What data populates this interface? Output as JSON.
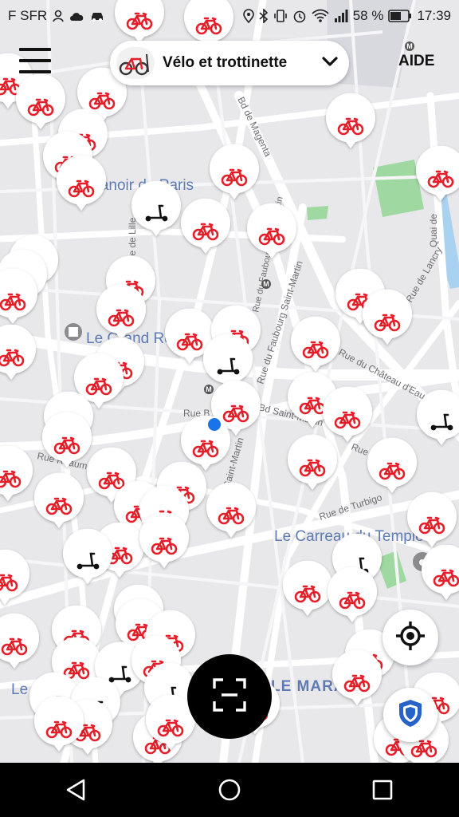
{
  "status_bar": {
    "carrier": "F SFR",
    "battery": "58 %",
    "time": "17:39",
    "icons": [
      "person-icon",
      "cloud-icon",
      "car-icon",
      "location-icon",
      "bluetooth-icon",
      "vibrate-icon",
      "alarm-icon",
      "wifi-icon",
      "signal-icon",
      "battery-icon"
    ]
  },
  "header": {
    "menu_icon": "hamburger-menu-icon",
    "mode_selector": {
      "label": "Vélo et trottinette",
      "icon": "bike-scooter-icon",
      "chevron": "chevron-down-icon"
    },
    "help_label": "AIDE"
  },
  "map": {
    "labels": {
      "street_bd_magenta": "Bd de Magenta",
      "street_faubourg_st_martin": "Rue du Faubourg Saint-Martin",
      "street_bd_st_martin": "Bd Saint-Martin",
      "street_rue_reaumur": "Rue Réaumur",
      "street_rue_meslay": "Rue Meslay",
      "street_rue_turbigo": "Rue de Turbigo",
      "street_chateau_eau": "Rue du Château d'Eau",
      "street_lancry": "Rue de Lancry",
      "street_quai": "Quai de",
      "street_ille": "Rue de Lille",
      "street_st_martin_short": "Saint-Martin",
      "poi_manoir": "Manoir de Paris",
      "poi_grand_rex": "Le Grand Rex",
      "poi_carreau": "Le Carreau du Temple",
      "poi_le_marais": "LE MARAIS",
      "poi_le_c": "Le C",
      "street_rue_b": "Rue B",
      "metro": "M"
    },
    "vehicle_icon_types": [
      "bike-icon",
      "scooter-icon"
    ],
    "colors": {
      "bike": "#e61e2a",
      "user_location": "#1a73e8",
      "park": "#9fd8a0",
      "water": "#a9d2f0"
    }
  },
  "controls": {
    "locate_icon": "crosshair-locate-icon",
    "safety_icon": "shield-icon",
    "scan_icon": "scan-qr-icon"
  },
  "navigation_bar": {
    "back": "back-triangle-icon",
    "home": "home-circle-icon",
    "recents": "recents-square-icon"
  }
}
